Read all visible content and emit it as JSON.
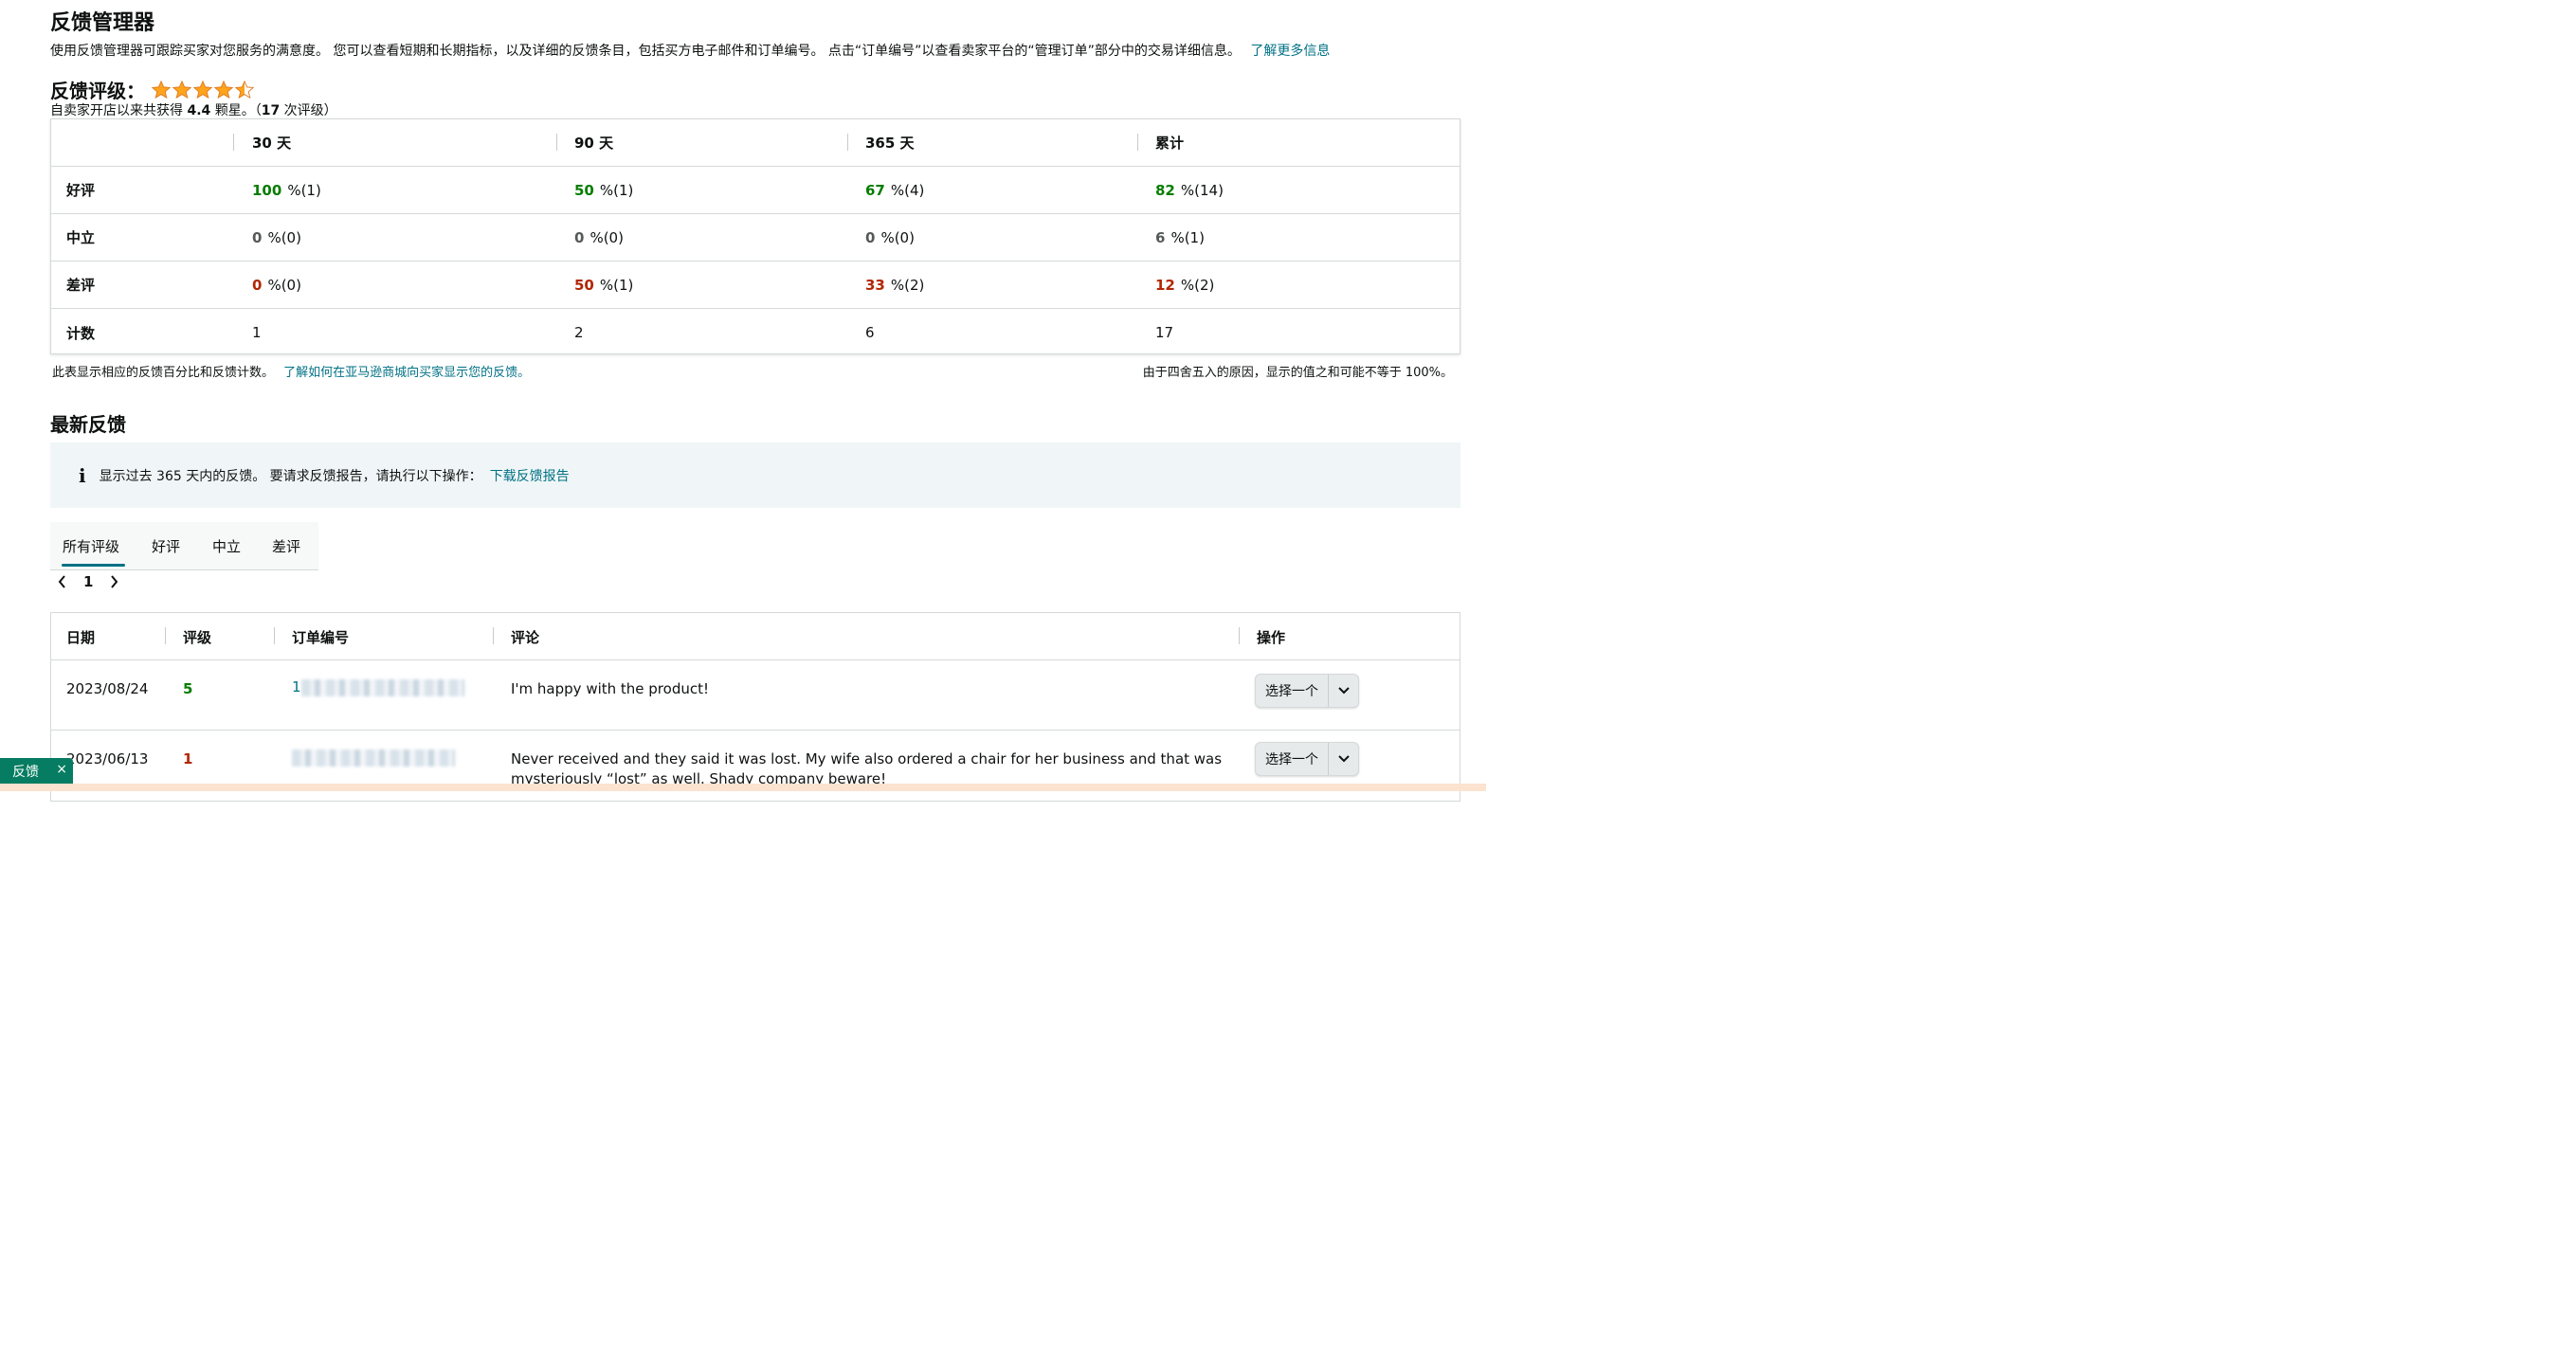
{
  "header": {
    "title": "反馈管理器",
    "description": "使用反馈管理器可跟踪买家对您服务的满意度。 您可以查看短期和长期指标，以及详细的反馈条目，包括买方电子邮件和订单编号。 点击“订单编号”以查看卖家平台的“管理订单”部分中的交易详细信息。",
    "learn_more": "了解更多信息"
  },
  "rating": {
    "label": "反馈评级：",
    "stars_value": 4.5,
    "sub_prefix": "自卖家开店以来共获得",
    "score": "4.4",
    "sub_mid": "颗星。（",
    "count": "17",
    "sub_suffix": "次评级）"
  },
  "summary": {
    "columns": [
      "30 天",
      "90 天",
      "365 天",
      "累计"
    ],
    "rows": [
      {
        "label": "好评",
        "cells": [
          {
            "v": "100",
            "p": "%(1)"
          },
          {
            "v": "50",
            "p": "%(1)"
          },
          {
            "v": "67",
            "p": "%(4)"
          },
          {
            "v": "82",
            "p": "%(14)"
          }
        ]
      },
      {
        "label": "中立",
        "cells": [
          {
            "v": "0",
            "p": "%(0)"
          },
          {
            "v": "0",
            "p": "%(0)"
          },
          {
            "v": "0",
            "p": "%(0)"
          },
          {
            "v": "6",
            "p": "%(1)"
          }
        ]
      },
      {
        "label": "差评",
        "cells": [
          {
            "v": "0",
            "p": "%(0)"
          },
          {
            "v": "50",
            "p": "%(1)"
          },
          {
            "v": "33",
            "p": "%(2)"
          },
          {
            "v": "12",
            "p": "%(2)"
          }
        ]
      },
      {
        "label": "计数",
        "cells": [
          {
            "v": "1",
            "p": ""
          },
          {
            "v": "2",
            "p": ""
          },
          {
            "v": "6",
            "p": ""
          },
          {
            "v": "17",
            "p": ""
          }
        ]
      }
    ],
    "colors": {
      "positive": "#067d00",
      "negative": "#b12704",
      "neutral": "#565959"
    }
  },
  "notes": {
    "left_text": "此表显示相应的反馈百分比和反馈计数。",
    "left_link": "了解如何在亚马逊商城向买家显示您的反馈。",
    "right_text": "由于四舍五入的原因，显示的值之和可能不等于 100%。"
  },
  "latest": {
    "title": "最新反馈",
    "info_icon": "i",
    "info_text": "显示过去 365 天内的反馈。 要请求反馈报告，请执行以下操作：",
    "info_link": "下载反馈报告"
  },
  "tabs": [
    "所有评级",
    "好评",
    "中立",
    "差评"
  ],
  "pager": {
    "page": "1"
  },
  "feedback_table": {
    "headers": [
      "日期",
      "评级",
      "订单编号",
      "评论",
      "操作"
    ],
    "rows": [
      {
        "date": "2023/08/24",
        "rating": "5",
        "order_prefix": "1",
        "comment": "I'm happy with the product!",
        "action": "选择一个"
      },
      {
        "date": "2023/06/13",
        "rating": "1",
        "order_prefix": "",
        "comment": "Never received and they said it was lost. My wife also ordered a chair for her business and that was",
        "comment2": "mysteriously “lost” as well. Shady company beware!",
        "action": "选择一个"
      }
    ]
  },
  "badge": {
    "label": "反馈",
    "close": "×"
  }
}
